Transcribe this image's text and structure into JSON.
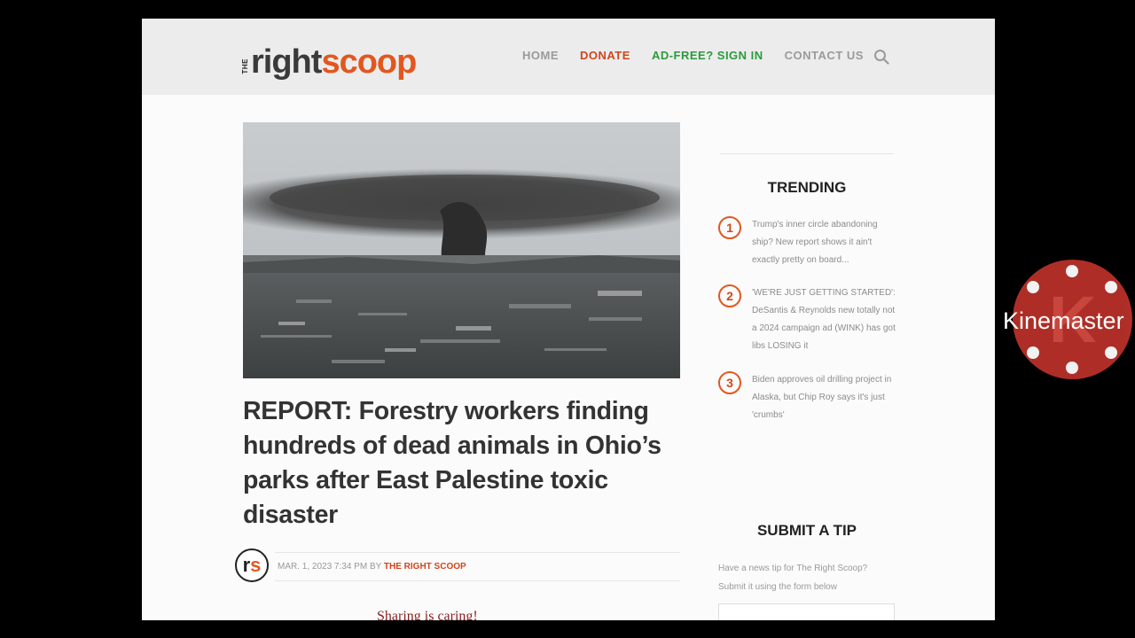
{
  "header": {
    "logo_the": "THE",
    "logo_right": "right",
    "logo_scoop": "scoop",
    "nav": {
      "home": "HOME",
      "donate": "DONATE",
      "adfree": "AD-FREE? SIGN IN",
      "contact": "CONTACT US"
    },
    "search_icon": "search-icon"
  },
  "article": {
    "headline": "REPORT: Forestry workers finding hundreds of dead animals in Ohio’s parks after East Palestine toxic disaster",
    "avatar_r": "r",
    "avatar_s": "s",
    "date": "MAR. 1, 2023 7:34 PM BY",
    "author": "THE RIGHT SCOOP",
    "sharing": "Sharing is caring!"
  },
  "sidebar": {
    "trending_title": "TRENDING",
    "trending": [
      {
        "num": "1",
        "text": "Trump's inner circle abandoning ship? New report shows it ain't exactly pretty on board..."
      },
      {
        "num": "2",
        "text": "'WE'RE JUST GETTING STARTED': DeSantis & Reynolds new totally not a 2024 campaign ad (WINK) has got libs LOSING it"
      },
      {
        "num": "3",
        "text": "Biden approves oil drilling project in Alaska, but Chip Roy says it's just 'crumbs'"
      }
    ],
    "tip_title": "SUBMIT A TIP",
    "tip_text": "Have a news tip for The Right Scoop? Submit it using the form below"
  },
  "watermark": {
    "label": "Kinemaster",
    "letter": "K"
  },
  "colors": {
    "accent": "#e2571f",
    "donate": "#d0461b",
    "adfree": "#2a9b3c",
    "watermark": "#b8312a"
  }
}
